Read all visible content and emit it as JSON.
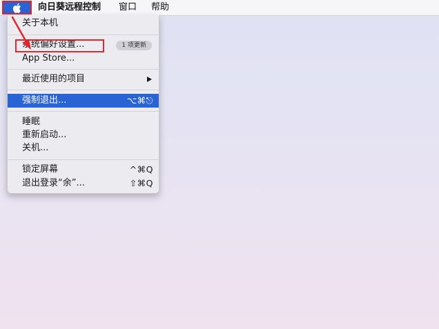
{
  "menubar": {
    "app_name": "向日葵远程控制",
    "window_label": "窗口",
    "help_label": "帮助"
  },
  "apple_menu": {
    "about": "关于本机",
    "system_prefs": "系统偏好设置...",
    "system_prefs_badge": "1 项更新",
    "app_store": "App Store...",
    "recent_items": "最近使用的项目",
    "force_quit": "强制退出...",
    "force_quit_shortcut": "⌥⌘⎋",
    "sleep": "睡眠",
    "restart": "重新启动...",
    "shutdown": "关机...",
    "lock_screen": "锁定屏幕",
    "lock_screen_shortcut": "^⌘Q",
    "logout": "退出登录“余”...",
    "logout_shortcut": "⇧⌘Q"
  },
  "colors": {
    "highlight": "#2a63d4",
    "annotation": "#e0262c"
  },
  "icons": {
    "apple": "apple-icon",
    "submenu": "chevron-right-icon",
    "annotation_arrow": "annotation-arrow-icon"
  }
}
